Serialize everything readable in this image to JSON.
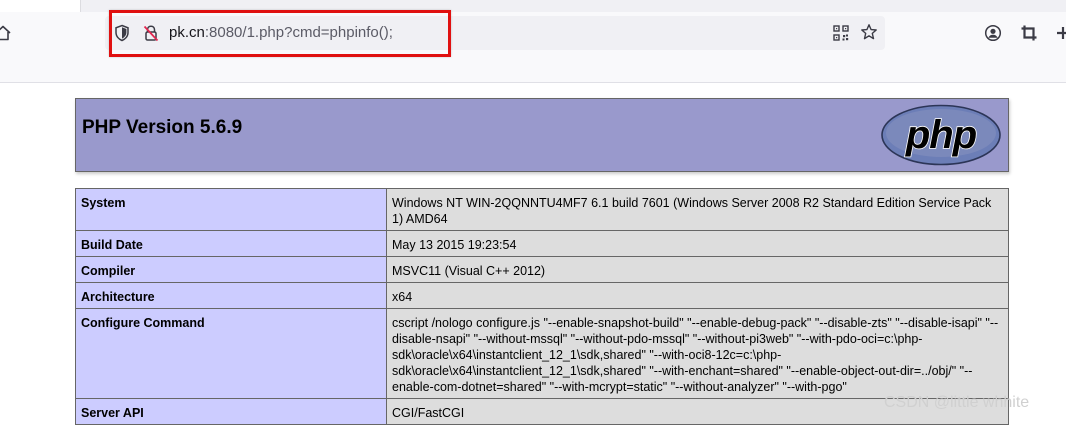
{
  "browser": {
    "url_host": "pk.cn",
    "url_rest": ":8080/1.php?cmd=phpinfo();"
  },
  "php": {
    "title": "PHP Version 5.6.9",
    "logo_text": "php",
    "rows": [
      {
        "key": "System",
        "value": "Windows NT WIN-2QQNNTU4MF7 6.1 build 7601 (Windows Server 2008 R2 Standard Edition Service Pack 1) AMD64"
      },
      {
        "key": "Build Date",
        "value": "May 13 2015 19:23:54"
      },
      {
        "key": "Compiler",
        "value": "MSVC11 (Visual C++ 2012)"
      },
      {
        "key": "Architecture",
        "value": "x64"
      },
      {
        "key": "Configure Command",
        "value": "cscript /nologo configure.js \"--enable-snapshot-build\" \"--enable-debug-pack\" \"--disable-zts\" \"--disable-isapi\" \"--disable-nsapi\" \"--without-mssql\" \"--without-pdo-mssql\" \"--without-pi3web\" \"--with-pdo-oci=c:\\php-sdk\\oracle\\x64\\instantclient_12_1\\sdk,shared\" \"--with-oci8-12c=c:\\php-sdk\\oracle\\x64\\instantclient_12_1\\sdk,shared\" \"--with-enchant=shared\" \"--enable-object-out-dir=../obj/\" \"--enable-com-dotnet=shared\" \"--with-mcrypt=static\" \"--without-analyzer\" \"--with-pgo\""
      },
      {
        "key": "Server API",
        "value": "CGI/FastCGI"
      }
    ]
  },
  "watermark": "CSDN @little whhite",
  "colors": {
    "header_bg": "#9999cc",
    "key_cell_bg": "#ccccff",
    "value_cell_bg": "#dddddd",
    "highlight": "#e01010"
  }
}
